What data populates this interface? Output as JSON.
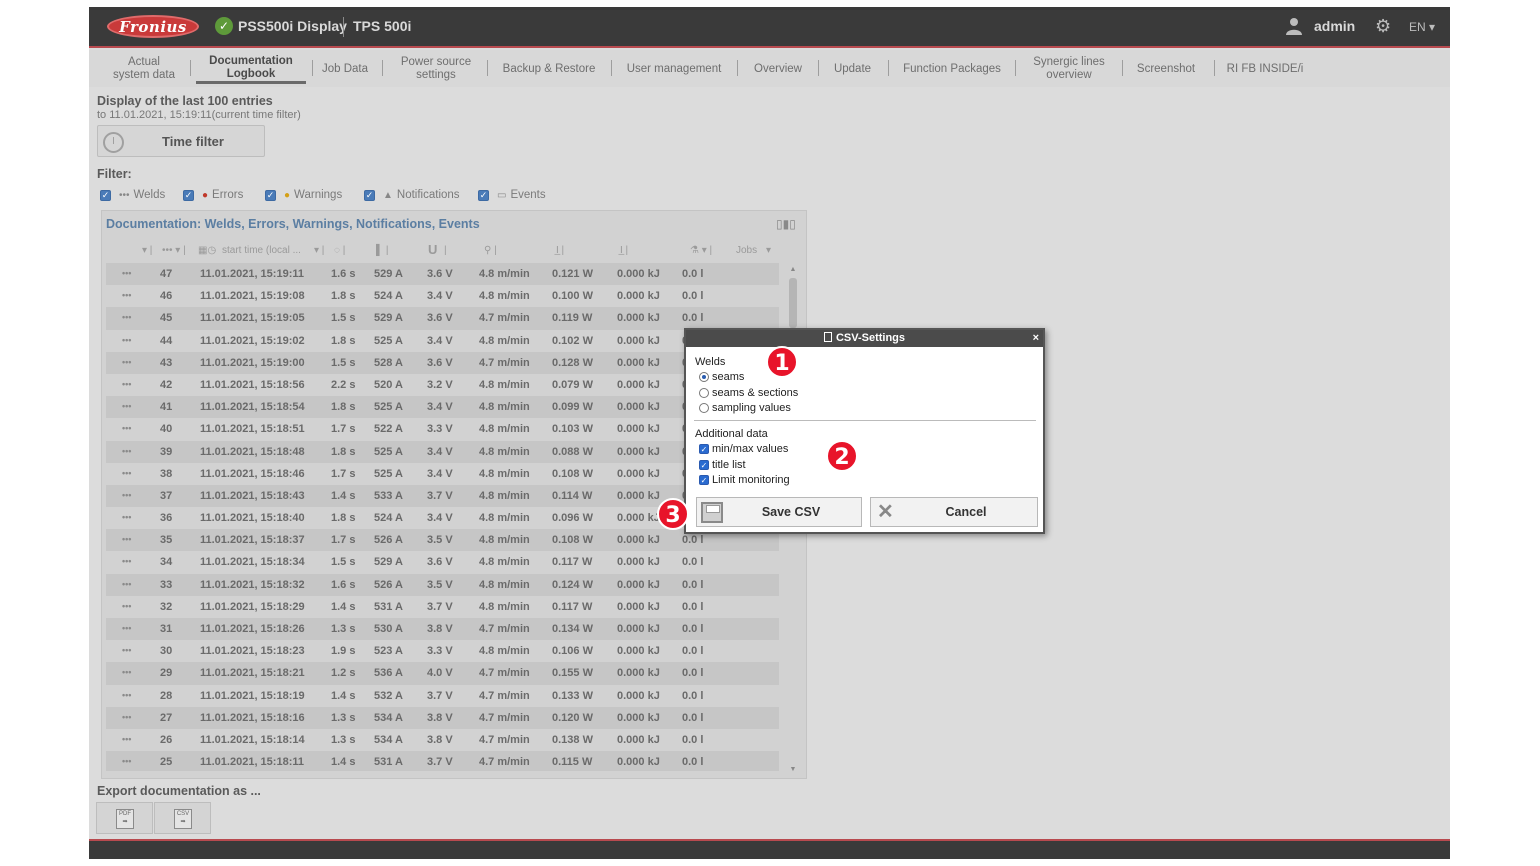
{
  "header": {
    "logo": "Fronius",
    "app_title": "PSS500i Display",
    "device": "TPS 500i",
    "user": "admin",
    "language": "EN ▾"
  },
  "nav": [
    {
      "label": "Actual\nsystem data"
    },
    {
      "label": "Documentation\nLogbook",
      "active": true
    },
    {
      "label": "Job Data"
    },
    {
      "label": "Power source\nsettings"
    },
    {
      "label": "Backup & Restore"
    },
    {
      "label": "User management"
    },
    {
      "label": "Overview"
    },
    {
      "label": "Update"
    },
    {
      "label": "Function Packages"
    },
    {
      "label": "Synergic lines\noverview"
    },
    {
      "label": "Screenshot"
    },
    {
      "label": "RI FB INSIDE/i"
    }
  ],
  "display": {
    "title": "Display of the last 100 entries",
    "subtitle": "to 11.01.2021, 15:19:11(current time filter)",
    "time_filter_label": "Time filter"
  },
  "filter": {
    "title": "Filter:",
    "items": [
      {
        "label": "Welds",
        "icon": "welds-icon",
        "checked": true
      },
      {
        "label": "Errors",
        "icon": "error-icon",
        "checked": true
      },
      {
        "label": "Warnings",
        "icon": "warning-icon",
        "checked": true
      },
      {
        "label": "Notifications",
        "icon": "notification-icon",
        "checked": true
      },
      {
        "label": "Events",
        "icon": "events-icon",
        "checked": true
      }
    ]
  },
  "documentation": {
    "title": "Documentation: Welds, Errors, Warnings, Notifications, Events",
    "columns": {
      "start_time": "start time (local ...",
      "voltage": "U",
      "jobs": "Jobs"
    },
    "rows": [
      {
        "no": "47",
        "time": "11.01.2021, 15:19:11",
        "dur": "1.6 s",
        "current": "529 A",
        "voltage": "3.6 V",
        "feed": "4.8 m/min",
        "power": "0.121 W",
        "energy": "0.000 kJ",
        "volume": "0.0 l"
      },
      {
        "no": "46",
        "time": "11.01.2021, 15:19:08",
        "dur": "1.8 s",
        "current": "524 A",
        "voltage": "3.4 V",
        "feed": "4.8 m/min",
        "power": "0.100 W",
        "energy": "0.000 kJ",
        "volume": "0.0 l"
      },
      {
        "no": "45",
        "time": "11.01.2021, 15:19:05",
        "dur": "1.5 s",
        "current": "529 A",
        "voltage": "3.6 V",
        "feed": "4.7 m/min",
        "power": "0.119 W",
        "energy": "0.000 kJ",
        "volume": "0.0 l"
      },
      {
        "no": "44",
        "time": "11.01.2021, 15:19:02",
        "dur": "1.8 s",
        "current": "525 A",
        "voltage": "3.4 V",
        "feed": "4.8 m/min",
        "power": "0.102 W",
        "energy": "0.000 kJ",
        "volume": "0.0 l"
      },
      {
        "no": "43",
        "time": "11.01.2021, 15:19:00",
        "dur": "1.5 s",
        "current": "528 A",
        "voltage": "3.6 V",
        "feed": "4.7 m/min",
        "power": "0.128 W",
        "energy": "0.000 kJ",
        "volume": "0.0 l"
      },
      {
        "no": "42",
        "time": "11.01.2021, 15:18:56",
        "dur": "2.2 s",
        "current": "520 A",
        "voltage": "3.2 V",
        "feed": "4.8 m/min",
        "power": "0.079 W",
        "energy": "0.000 kJ",
        "volume": "0.0 l"
      },
      {
        "no": "41",
        "time": "11.01.2021, 15:18:54",
        "dur": "1.8 s",
        "current": "525 A",
        "voltage": "3.4 V",
        "feed": "4.8 m/min",
        "power": "0.099 W",
        "energy": "0.000 kJ",
        "volume": "0.0 l"
      },
      {
        "no": "40",
        "time": "11.01.2021, 15:18:51",
        "dur": "1.7 s",
        "current": "522 A",
        "voltage": "3.3 V",
        "feed": "4.8 m/min",
        "power": "0.103 W",
        "energy": "0.000 kJ",
        "volume": "0.0 l"
      },
      {
        "no": "39",
        "time": "11.01.2021, 15:18:48",
        "dur": "1.8 s",
        "current": "525 A",
        "voltage": "3.4 V",
        "feed": "4.8 m/min",
        "power": "0.088 W",
        "energy": "0.000 kJ",
        "volume": "0.0 l"
      },
      {
        "no": "38",
        "time": "11.01.2021, 15:18:46",
        "dur": "1.7 s",
        "current": "525 A",
        "voltage": "3.4 V",
        "feed": "4.8 m/min",
        "power": "0.108 W",
        "energy": "0.000 kJ",
        "volume": "0.0 l"
      },
      {
        "no": "37",
        "time": "11.01.2021, 15:18:43",
        "dur": "1.4 s",
        "current": "533 A",
        "voltage": "3.7 V",
        "feed": "4.8 m/min",
        "power": "0.114 W",
        "energy": "0.000 kJ",
        "volume": "0.0 l"
      },
      {
        "no": "36",
        "time": "11.01.2021, 15:18:40",
        "dur": "1.8 s",
        "current": "524 A",
        "voltage": "3.4 V",
        "feed": "4.8 m/min",
        "power": "0.096 W",
        "energy": "0.000 kJ",
        "volume": "0.0 l"
      },
      {
        "no": "35",
        "time": "11.01.2021, 15:18:37",
        "dur": "1.7 s",
        "current": "526 A",
        "voltage": "3.5 V",
        "feed": "4.8 m/min",
        "power": "0.108 W",
        "energy": "0.000 kJ",
        "volume": "0.0 l"
      },
      {
        "no": "34",
        "time": "11.01.2021, 15:18:34",
        "dur": "1.5 s",
        "current": "529 A",
        "voltage": "3.6 V",
        "feed": "4.8 m/min",
        "power": "0.117 W",
        "energy": "0.000 kJ",
        "volume": "0.0 l"
      },
      {
        "no": "33",
        "time": "11.01.2021, 15:18:32",
        "dur": "1.6 s",
        "current": "526 A",
        "voltage": "3.5 V",
        "feed": "4.8 m/min",
        "power": "0.124 W",
        "energy": "0.000 kJ",
        "volume": "0.0 l"
      },
      {
        "no": "32",
        "time": "11.01.2021, 15:18:29",
        "dur": "1.4 s",
        "current": "531 A",
        "voltage": "3.7 V",
        "feed": "4.8 m/min",
        "power": "0.117 W",
        "energy": "0.000 kJ",
        "volume": "0.0 l"
      },
      {
        "no": "31",
        "time": "11.01.2021, 15:18:26",
        "dur": "1.3 s",
        "current": "530 A",
        "voltage": "3.8 V",
        "feed": "4.7 m/min",
        "power": "0.134 W",
        "energy": "0.000 kJ",
        "volume": "0.0 l"
      },
      {
        "no": "30",
        "time": "11.01.2021, 15:18:23",
        "dur": "1.9 s",
        "current": "523 A",
        "voltage": "3.3 V",
        "feed": "4.8 m/min",
        "power": "0.106 W",
        "energy": "0.000 kJ",
        "volume": "0.0 l"
      },
      {
        "no": "29",
        "time": "11.01.2021, 15:18:21",
        "dur": "1.2 s",
        "current": "536 A",
        "voltage": "4.0 V",
        "feed": "4.7 m/min",
        "power": "0.155 W",
        "energy": "0.000 kJ",
        "volume": "0.0 l"
      },
      {
        "no": "28",
        "time": "11.01.2021, 15:18:19",
        "dur": "1.4 s",
        "current": "532 A",
        "voltage": "3.7 V",
        "feed": "4.7 m/min",
        "power": "0.133 W",
        "energy": "0.000 kJ",
        "volume": "0.0 l"
      },
      {
        "no": "27",
        "time": "11.01.2021, 15:18:16",
        "dur": "1.3 s",
        "current": "534 A",
        "voltage": "3.8 V",
        "feed": "4.7 m/min",
        "power": "0.120 W",
        "energy": "0.000 kJ",
        "volume": "0.0 l"
      },
      {
        "no": "26",
        "time": "11.01.2021, 15:18:14",
        "dur": "1.3 s",
        "current": "534 A",
        "voltage": "3.8 V",
        "feed": "4.7 m/min",
        "power": "0.138 W",
        "energy": "0.000 kJ",
        "volume": "0.0 l"
      },
      {
        "no": "25",
        "time": "11.01.2021, 15:18:11",
        "dur": "1.4 s",
        "current": "531 A",
        "voltage": "3.7 V",
        "feed": "4.7 m/min",
        "power": "0.115 W",
        "energy": "0.000 kJ",
        "volume": "0.0 l"
      }
    ]
  },
  "export": {
    "title": "Export documentation as ...",
    "pdf_label": "PDF",
    "csv_label": "CSV"
  },
  "dialog": {
    "title": "CSV-Settings",
    "close": "×",
    "welds_label": "Welds",
    "weld_options": [
      {
        "label": "seams",
        "selected": true
      },
      {
        "label": "seams & sections",
        "selected": false
      },
      {
        "label": "sampling values",
        "selected": false
      }
    ],
    "additional_label": "Additional data",
    "additional_options": [
      {
        "label": "min/max values",
        "checked": true
      },
      {
        "label": "title list",
        "checked": true
      },
      {
        "label": "Limit monitoring",
        "checked": true
      }
    ],
    "save_label": "Save CSV",
    "cancel_label": "Cancel"
  },
  "markers": [
    "1",
    "2",
    "3"
  ],
  "colors": {
    "brand_red": "#c93a3a",
    "marker_red": "#e8142a",
    "title_blue": "#5b7ea2",
    "checkbox_blue": "#2a6bd0"
  }
}
